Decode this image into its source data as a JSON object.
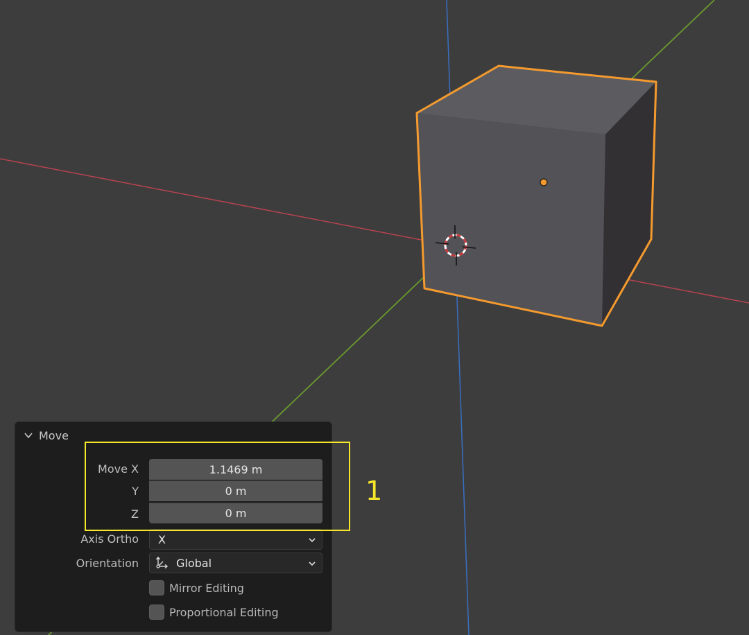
{
  "viewport": {
    "axis_colors": {
      "x": "#b8434f",
      "y": "#6b9a2e",
      "z": "#3a6fc1"
    },
    "selection_outline_color": "#f59a2e",
    "object_icon": "cube-mesh",
    "cursor_icon": "3d-cursor-icon"
  },
  "redo_panel": {
    "title": "Move",
    "move": {
      "x_label": "Move X",
      "y_label": "Y",
      "z_label": "Z",
      "x_value": "1.1469 m",
      "y_value": "0 m",
      "z_value": "0 m"
    },
    "axis_ortho": {
      "label": "Axis Ortho",
      "value": "X"
    },
    "orientation": {
      "label": "Orientation",
      "value": "Global",
      "icon": "orientation-global-icon"
    },
    "mirror_editing": {
      "label": "Mirror Editing",
      "checked": false
    },
    "proportional_editing": {
      "label": "Proportional Editing",
      "checked": false
    }
  },
  "annotation": {
    "label": "1",
    "color": "#f5e82a"
  }
}
